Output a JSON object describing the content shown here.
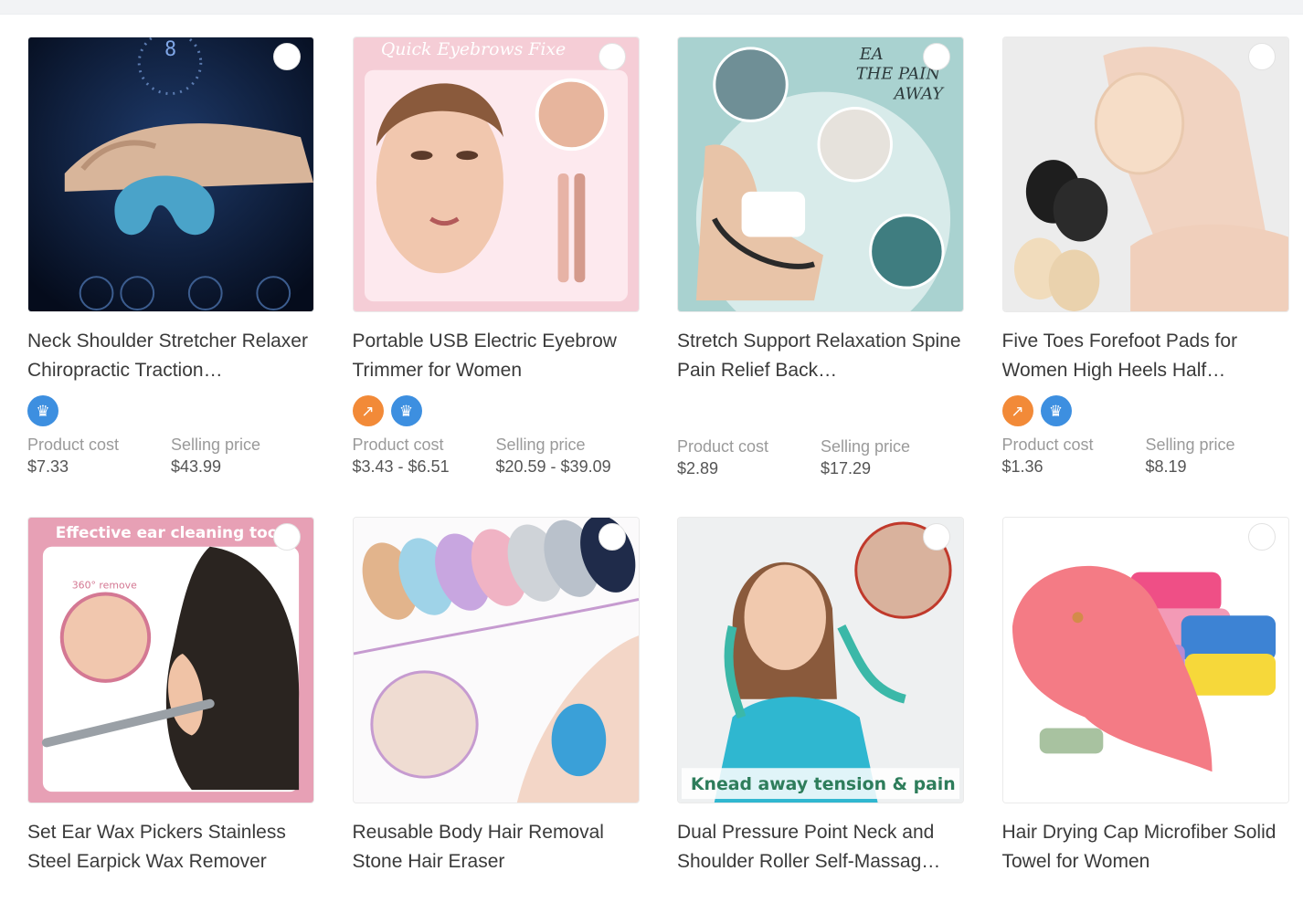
{
  "products": [
    {
      "title": "Neck Shoulder Stretcher Relaxer Chiropractic Traction…",
      "image_overlay_text": "",
      "badges": [
        "crown-icon"
      ],
      "product_cost_label": "Product cost",
      "product_cost": "$7.33",
      "selling_price_label": "Selling price",
      "selling_price": "$43.99"
    },
    {
      "title": "Portable USB Electric Eyebrow Trimmer for Women",
      "image_overlay_text": "Quick Eyebrows Fixe",
      "badges": [
        "trend-icon",
        "crown-icon"
      ],
      "product_cost_label": "Product cost",
      "product_cost": "$3.43 - $6.51",
      "selling_price_label": "Selling price",
      "selling_price": "$20.59 - $39.09"
    },
    {
      "title": "Stretch Support Relaxation Spine Pain Relief Back…",
      "image_overlay_text": "EA THE PAIN AWAY",
      "badges": [],
      "product_cost_label": "Product cost",
      "product_cost": "$2.89",
      "selling_price_label": "Selling price",
      "selling_price": "$17.29"
    },
    {
      "title": "Five Toes Forefoot Pads for Women High Heels Half…",
      "image_overlay_text": "",
      "badges": [
        "trend-icon",
        "crown-icon"
      ],
      "product_cost_label": "Product cost",
      "product_cost": "$1.36",
      "selling_price_label": "Selling price",
      "selling_price": "$8.19"
    },
    {
      "title": "Set Ear Wax Pickers Stainless Steel Earpick Wax Remover",
      "image_overlay_text": "Effective ear cleaning tool",
      "image_sub_text": "360° remove"
    },
    {
      "title": "Reusable Body Hair Removal Stone Hair Eraser",
      "image_overlay_text": ""
    },
    {
      "title": "Dual Pressure Point Neck and Shoulder Roller Self-Massag…",
      "image_overlay_text": "Knead away tension & pain"
    },
    {
      "title": "Hair Drying Cap Microfiber Solid Towel for Women",
      "image_overlay_text": ""
    }
  ],
  "colors": {
    "crown_badge": "#3d8fe0",
    "trend_badge": "#f28a38",
    "label_gray": "#9a9a9a"
  }
}
